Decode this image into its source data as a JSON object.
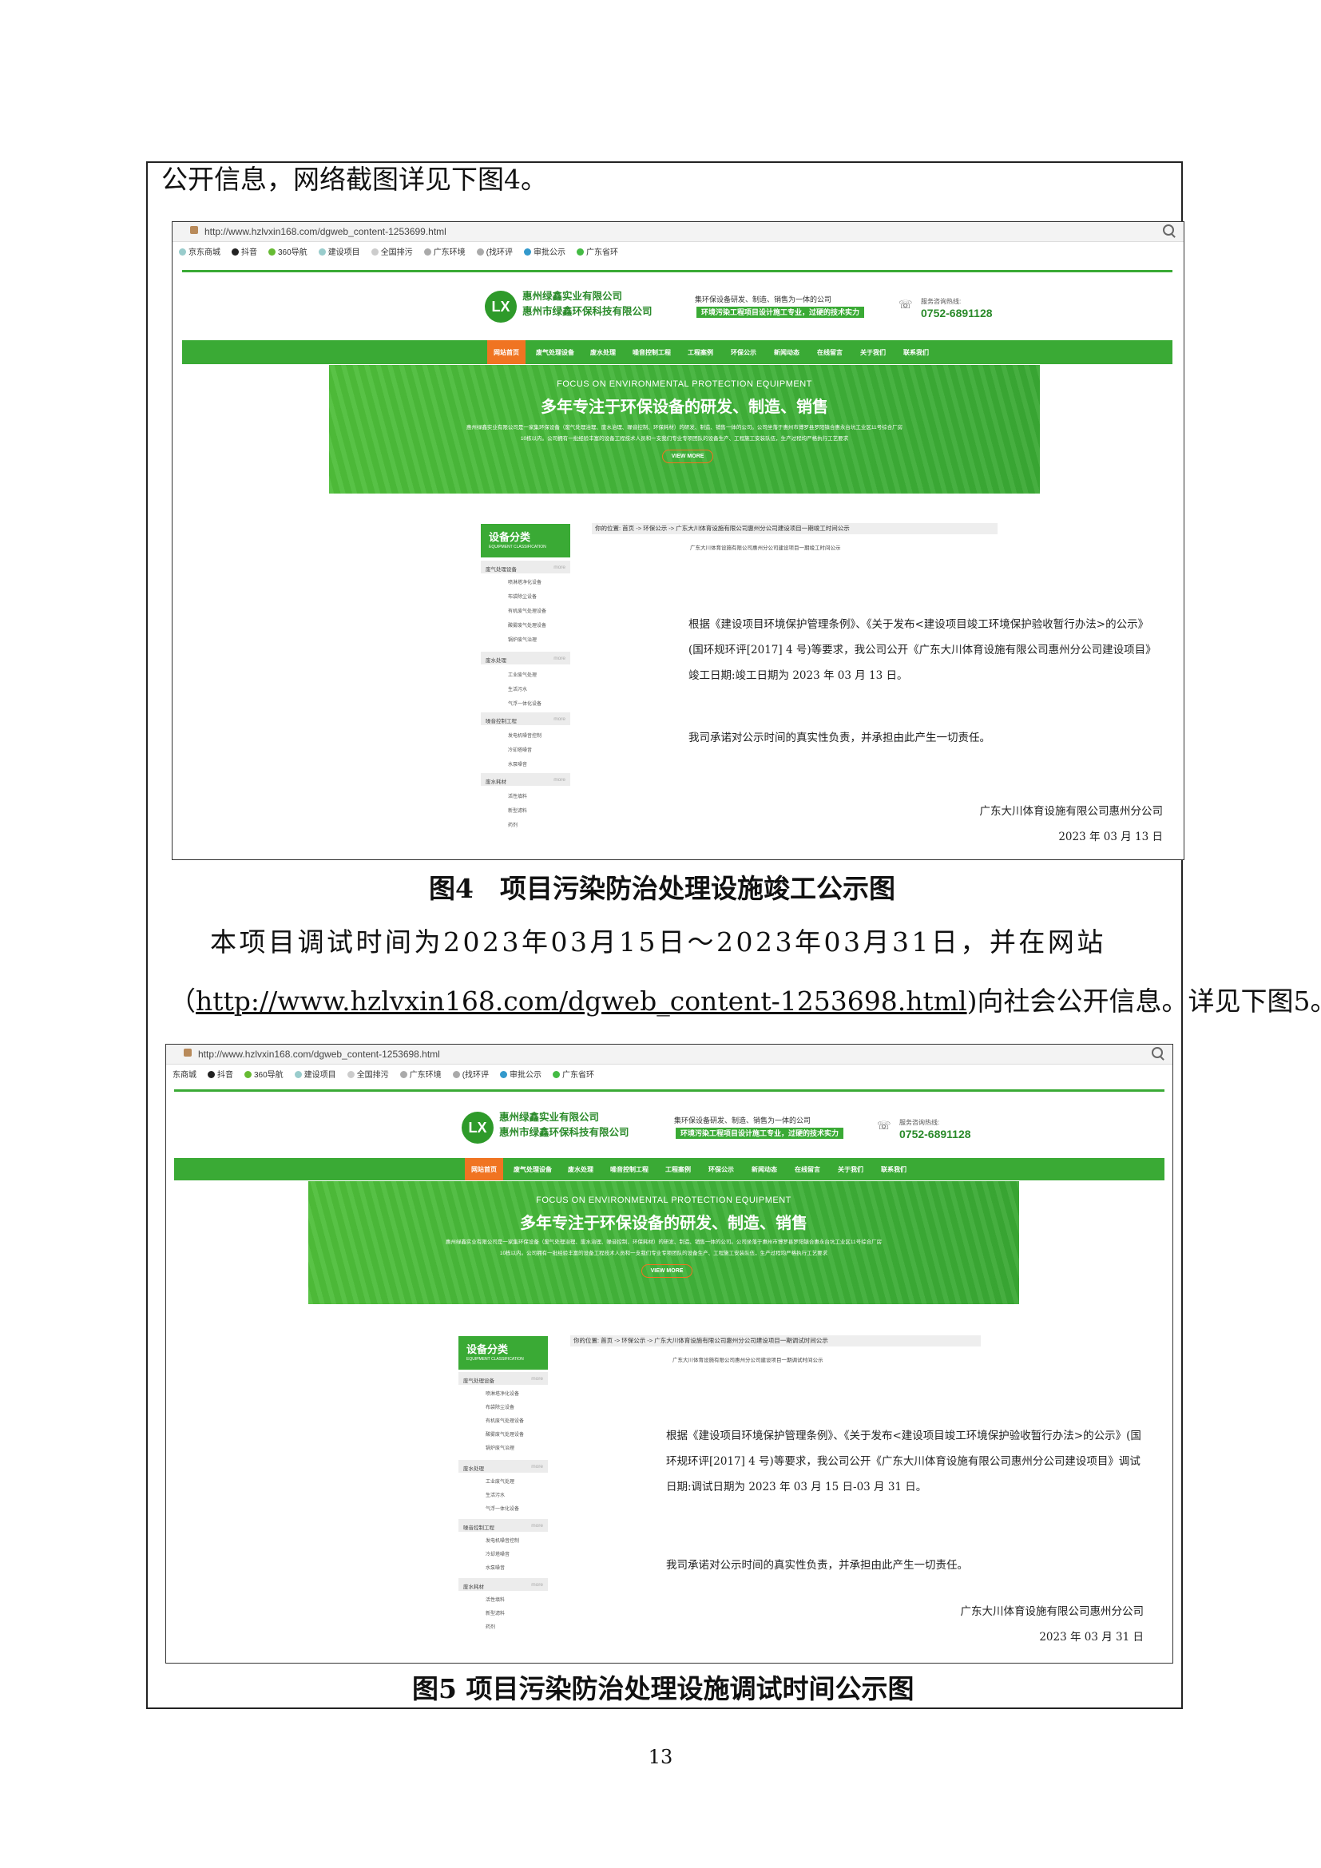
{
  "doc": {
    "intro_line": "公开信息，网络截图详见下图4。",
    "fig4_caption": "图4　项目污染防治处理设施竣工公示图",
    "para_line1": "本项目调试时间为2023年03月15日～2023年03月31日，并在网站",
    "para_url": "http://www.hzlvxin168.com/dgweb_content-1253698.html",
    "para_open": "（",
    "para_rest": ")向社会公开信息。详见下图5。",
    "fig5_caption": "图5 项目污染防治处理设施调试时间公示图",
    "page_number": "13"
  },
  "site": {
    "logo_text": "LX",
    "company_name_1": "惠州绿鑫实业有限公司",
    "company_name_2": "惠州市绿鑫环保科技有限公司",
    "slogan_1": "集环保设备研发、制造、销售为一体的公司",
    "slogan_2": "环境污染工程项目设计施工专业，过硬的技术实力",
    "hotline_label": "服务咨询热线:",
    "hotline": "0752-6891128",
    "nav": [
      "网站首页",
      "废气处理设备",
      "废水处理",
      "噪音控制工程",
      "工程案例",
      "环保公示",
      "新闻动态",
      "在线留言",
      "关于我们",
      "联系我们"
    ],
    "banner_sub": "FOCUS ON ENVIRONMENTAL PROTECTION EQUIPMENT",
    "banner_head": "多年专注于环保设备的研发、制造、销售",
    "banner_desc_1": "惠州绿鑫实业有限公司是一家集环保设备（废气处理治理、废水治理、噪音控制、环保耗材）的研发、制造、销售一体的公司。公司坐落于惠州市博罗县罗阳镇合惠永台坑工业区11号综合厂房",
    "banner_desc_2": "10栋以内。公司拥有一批经验丰富的设备工程技术人员和一支我们专业专项团队的设备生产、工程施工安装队伍，生产过程均严格执行工艺要求",
    "banner_btn": "VIEW MORE",
    "sidebar_title": "设备分类",
    "sidebar_subtitle": "EQUIPMENT CLASSIFICATION",
    "sidebar_more": "more",
    "sidebar": [
      {
        "cat": "废气处理设备",
        "items": [
          "喷淋塔净化设备",
          "布袋除尘设备",
          "有机废气处理设备",
          "酸雾废气处理设备",
          "锅炉废气治理"
        ]
      },
      {
        "cat": "废水处理",
        "items": [
          "工业废气处理",
          "生活污水",
          "气浮一体化设备"
        ]
      },
      {
        "cat": "噪音控制工程",
        "items": [
          "发电机噪音控制",
          "冷却塔噪音",
          "水泵噪音"
        ]
      },
      {
        "cat": "废水耗材",
        "items": [
          "活性填料",
          "新型滤料",
          "药剂"
        ]
      }
    ]
  },
  "shot4": {
    "url": "http://www.hzlvxin168.com/dgweb_content-1253699.html",
    "bookmarks": [
      "京东商城",
      "抖音",
      "360导航",
      "建设项目",
      "全国排污",
      "广东环境",
      "(找环评",
      "审批公示",
      "广东省环"
    ],
    "crumb": "你的位置: 首页 -> 环保公示 -> 广东大川体育设施有限公司惠州分公司建设项目一期竣工时间公示",
    "article_title": "广东大川体育设施有限公司惠州分公司建设项目一期竣工时间公示",
    "p1": "根据《建设项目环境保护管理条例》、《关于发布<建设项目竣工环境保护验收暂行办法>的公示》(国环规环评[2017] 4 号)等要求，我公司公开《广东大川体育设施有限公司惠州分公司建设项目》竣工日期:竣工日期为 2023 年 03 月 13 日。",
    "p2": "我司承诺对公示时间的真实性负责，并承担由此产生一切责任。",
    "sign_company": "广东大川体育设施有限公司惠州分公司",
    "sign_date": "2023 年 03 月 13 日"
  },
  "shot5": {
    "url": "http://www.hzlvxin168.com/dgweb_content-1253698.html",
    "bookmarks": [
      "东商城",
      "抖音",
      "360导航",
      "建设项目",
      "全国排污",
      "广东环境",
      "(找环评",
      "审批公示",
      "广东省环"
    ],
    "crumb": "你的位置: 首页 -> 环保公示 -> 广东大川体育设施有限公司惠州分公司建设项目一期调试时间公示",
    "article_title": "广东大川体育设施有限公司惠州分公司建设项目一期调试时间公示",
    "p1": "根据《建设项目环境保护管理条例》、《关于发布<建设项目竣工环境保护验收暂行办法>的公示》(国环规环评[2017] 4 号)等要求，我公司公开《广东大川体育设施有限公司惠州分公司建设项目》调试日期:调试日期为 2023 年 03 月 15 日-03 月 31 日。",
    "p2": "我司承诺对公示时间的真实性负责，并承担由此产生一切责任。",
    "sign_company": "广东大川体育设施有限公司惠州分公司",
    "sign_date": "2023 年 03 月 31 日"
  },
  "colors": {
    "brand_green": "#3aaa35",
    "nav_active": "#f07422"
  }
}
